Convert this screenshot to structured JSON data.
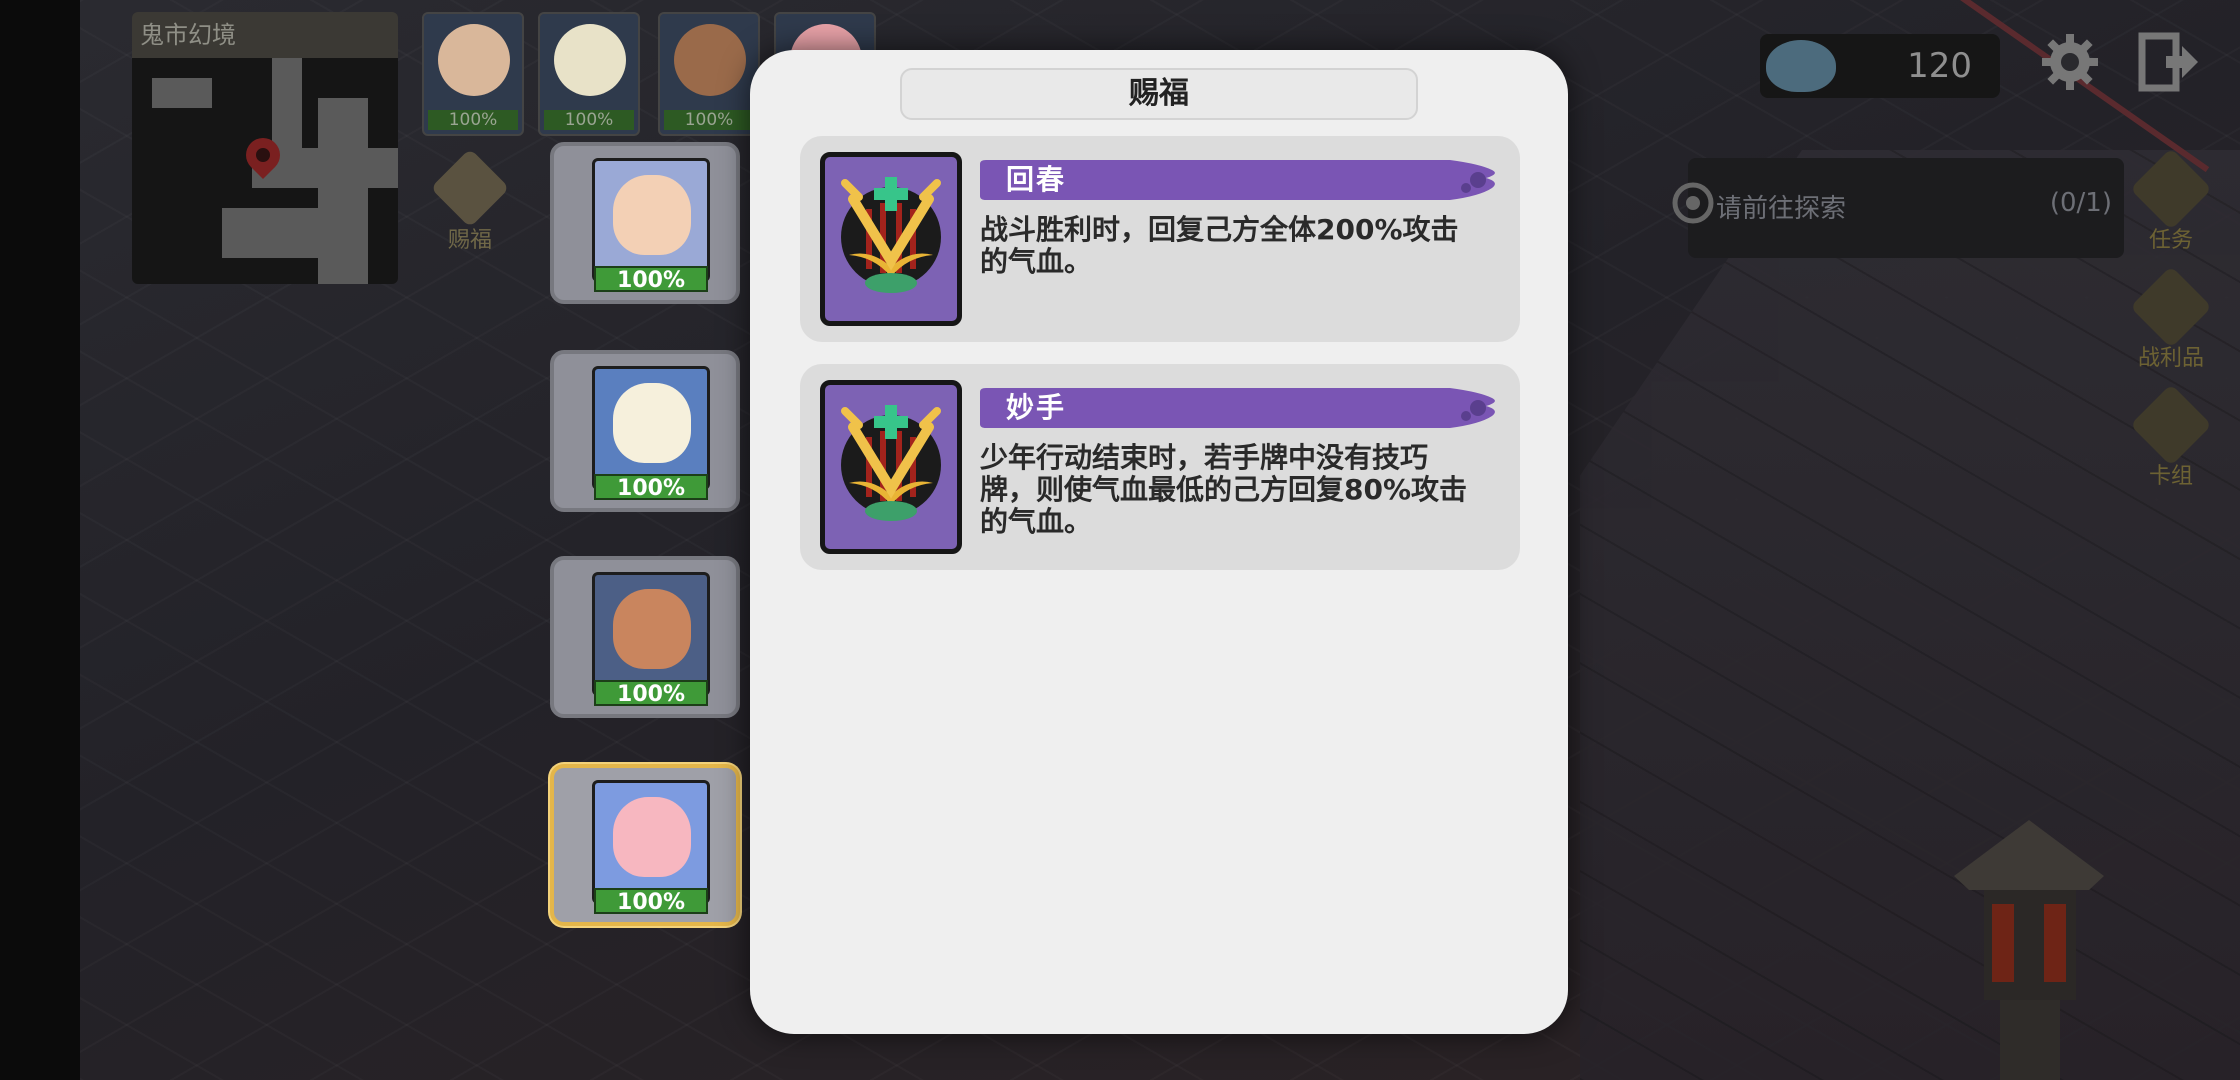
{
  "minimap": {
    "title": "鬼市幻境"
  },
  "top_party": [
    {
      "hp": "100%",
      "color": "#d9b79a"
    },
    {
      "hp": "100%",
      "color": "#e8e2c8"
    },
    {
      "hp": "100%",
      "color": "#9a6a4a"
    },
    {
      "hp": "",
      "color": "#e8a2a8"
    }
  ],
  "blessing_button": {
    "label": "赐福"
  },
  "party": [
    {
      "hp": "100%",
      "bg": "#9aa9d6",
      "face": "#f3d0b5"
    },
    {
      "hp": "100%",
      "bg": "#5a7fbf",
      "face": "#f6f0dc"
    },
    {
      "hp": "100%",
      "bg": "#4c5f86",
      "face": "#c9855e"
    },
    {
      "hp": "100%",
      "bg": "#7d9be0",
      "face": "#f7b7c0"
    }
  ],
  "hud": {
    "currency": "120",
    "accent": "#e4b64a"
  },
  "quest": {
    "text": "请前往探索",
    "count": "(0/1)"
  },
  "side_buttons": [
    {
      "label": "任务",
      "icon": "exclamation-icon"
    },
    {
      "label": "战利品",
      "icon": "loot-icon"
    },
    {
      "label": "卡组",
      "icon": "deck-icon"
    }
  ],
  "modal": {
    "title": "赐福",
    "blessings": [
      {
        "name": "回春",
        "description": "战斗胜利时，回复己方全体200%攻击的气血。"
      },
      {
        "name": "妙手",
        "description": "少年行动结束时，若手牌中没有技巧牌，则使气血最低的己方回复80%攻击的气血。"
      }
    ]
  }
}
